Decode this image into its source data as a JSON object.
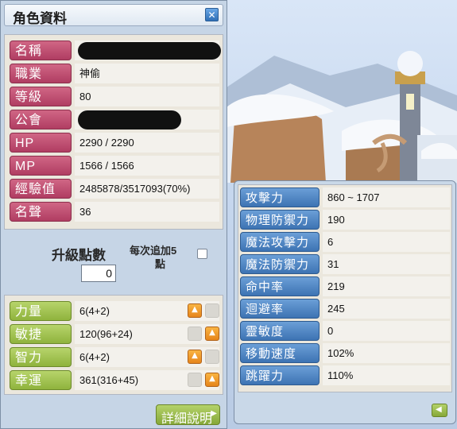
{
  "window_title": "角色資料",
  "profile": {
    "rows": [
      {
        "label": "名稱",
        "value": ""
      },
      {
        "label": "職業",
        "value": "神偷"
      },
      {
        "label": "等級",
        "value": "80"
      },
      {
        "label": "公會",
        "value": ""
      },
      {
        "label": "HP",
        "value": "2290 / 2290"
      },
      {
        "label": "MP",
        "value": "1566 / 1566"
      },
      {
        "label": "經驗值",
        "value": "2485878/3517093(70%)"
      },
      {
        "label": "名聲",
        "value": "36"
      }
    ]
  },
  "levelup": {
    "label": "升級點數",
    "points": "0",
    "auto_add_line1": "每次追加5",
    "auto_add_line2": "點"
  },
  "attributes": [
    {
      "label": "力量",
      "value": "6(4+2)"
    },
    {
      "label": "敏捷",
      "value": "120(96+24)"
    },
    {
      "label": "智力",
      "value": "6(4+2)"
    },
    {
      "label": "幸運",
      "value": "361(316+45)"
    }
  ],
  "details_button": "詳細說明",
  "stats": [
    {
      "label": "攻擊力",
      "value": "860 ~ 1707"
    },
    {
      "label": "物理防禦力",
      "value": "190"
    },
    {
      "label": "魔法攻擊力",
      "value": "6"
    },
    {
      "label": "魔法防禦力",
      "value": "31"
    },
    {
      "label": "命中率",
      "value": "219"
    },
    {
      "label": "迴避率",
      "value": "245"
    },
    {
      "label": "靈敏度",
      "value": "0"
    },
    {
      "label": "移動速度",
      "value": "102%"
    },
    {
      "label": "跳躍力",
      "value": "110%"
    }
  ],
  "colors": {
    "label_pink": "#b03d62",
    "label_green": "#8fb33d",
    "label_blue": "#3d73b3",
    "window_bg": "#c6d5e6"
  }
}
